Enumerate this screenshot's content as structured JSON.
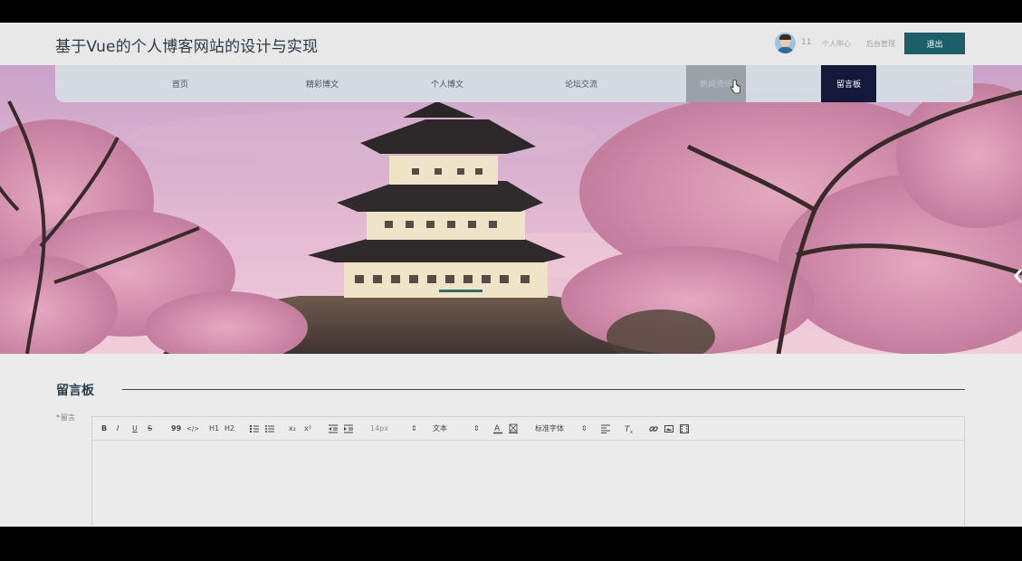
{
  "header": {
    "site_title": "基于Vue的个人博客网站的设计与实现",
    "user_number": "11",
    "personal_center": "个人中心",
    "admin": "后台管理",
    "logout": "退出"
  },
  "nav": {
    "items": [
      {
        "label": "首页"
      },
      {
        "label": "精彩博文"
      },
      {
        "label": "个人博文"
      },
      {
        "label": "论坛交流"
      },
      {
        "label": "新闻资讯"
      },
      {
        "label": "留言板"
      }
    ]
  },
  "section": {
    "title": "留言板",
    "field_label": "留言",
    "required_mark": "*"
  },
  "toolbar": {
    "bold": "B",
    "italic": "I",
    "underline": "U",
    "strike": "S",
    "quote": "99",
    "code": "</>",
    "h1": "H1",
    "h2": "H2",
    "sub": "x₂",
    "sup": "x²",
    "size": "14px",
    "header_select": "文本",
    "font_select": "标准字体",
    "size_arrow": "⇕",
    "header_arrow": "⇕",
    "font_arrow": "⇕"
  },
  "colors": {
    "accent": "#1d5f69",
    "nav_active": "#14193a"
  }
}
